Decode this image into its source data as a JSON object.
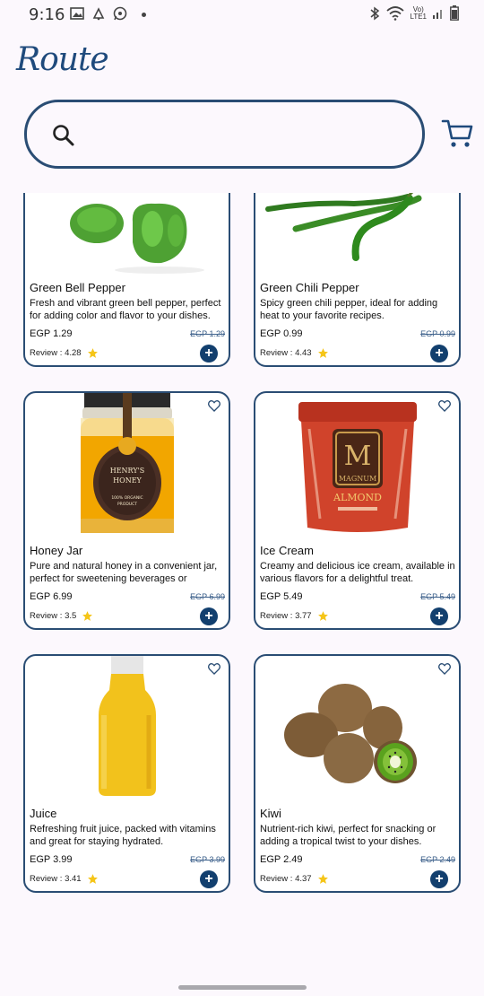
{
  "status": {
    "time": "9:16",
    "lte_top": "Vo)",
    "lte_bottom": "LTE1"
  },
  "app": {
    "logo": "Route"
  },
  "search": {
    "placeholder": ""
  },
  "colors": {
    "accent": "#2a4d74",
    "button": "#123f6e",
    "star": "#f5c518"
  },
  "products": [
    {
      "name": "Green Bell Pepper",
      "description": "Fresh and vibrant green bell pepper, perfect for adding color and flavor to your dishes.",
      "price": "EGP 1.29",
      "old_price": "EGP 1.29",
      "review": "Review : 4.28"
    },
    {
      "name": "Green Chili Pepper",
      "description": "Spicy green chili pepper, ideal for adding heat to your favorite recipes.",
      "price": "EGP 0.99",
      "old_price": "EGP 0.99",
      "review": "Review : 4.43"
    },
    {
      "name": "Honey Jar",
      "description": "Pure and natural honey in a convenient jar, perfect for sweetening beverages or",
      "price": "EGP 6.99",
      "old_price": "EGP 6.99",
      "review": "Review : 3.5",
      "label_lines": [
        "HENRY'S",
        "HONEY",
        "100% ORGANIC",
        "PRODUCT"
      ]
    },
    {
      "name": "Ice Cream",
      "description": "Creamy and delicious ice cream, available in various flavors for a delightful treat.",
      "price": "EGP 5.49",
      "old_price": "EGP 5.49",
      "review": "Review : 3.77",
      "label_lines": [
        "M",
        "MAGNUM",
        "ALMOND"
      ]
    },
    {
      "name": "Juice",
      "description": "Refreshing fruit juice, packed with vitamins and great for staying hydrated.",
      "price": "EGP 3.99",
      "old_price": "EGP 3.99",
      "review": "Review : 3.41"
    },
    {
      "name": "Kiwi",
      "description": "Nutrient-rich kiwi, perfect for snacking or adding a tropical twist to your dishes.",
      "price": "EGP 2.49",
      "old_price": "EGP 2.49",
      "review": "Review : 4.37"
    }
  ]
}
